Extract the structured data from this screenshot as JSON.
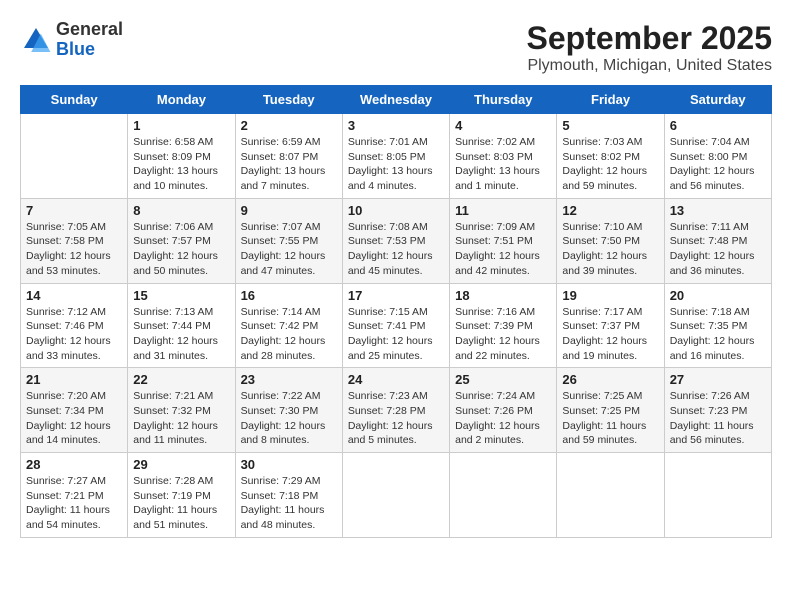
{
  "logo": {
    "general": "General",
    "blue": "Blue"
  },
  "title": "September 2025",
  "subtitle": "Plymouth, Michigan, United States",
  "days_of_week": [
    "Sunday",
    "Monday",
    "Tuesday",
    "Wednesday",
    "Thursday",
    "Friday",
    "Saturday"
  ],
  "weeks": [
    [
      {
        "day": "",
        "info": ""
      },
      {
        "day": "1",
        "info": "Sunrise: 6:58 AM\nSunset: 8:09 PM\nDaylight: 13 hours\nand 10 minutes."
      },
      {
        "day": "2",
        "info": "Sunrise: 6:59 AM\nSunset: 8:07 PM\nDaylight: 13 hours\nand 7 minutes."
      },
      {
        "day": "3",
        "info": "Sunrise: 7:01 AM\nSunset: 8:05 PM\nDaylight: 13 hours\nand 4 minutes."
      },
      {
        "day": "4",
        "info": "Sunrise: 7:02 AM\nSunset: 8:03 PM\nDaylight: 13 hours\nand 1 minute."
      },
      {
        "day": "5",
        "info": "Sunrise: 7:03 AM\nSunset: 8:02 PM\nDaylight: 12 hours\nand 59 minutes."
      },
      {
        "day": "6",
        "info": "Sunrise: 7:04 AM\nSunset: 8:00 PM\nDaylight: 12 hours\nand 56 minutes."
      }
    ],
    [
      {
        "day": "7",
        "info": "Sunrise: 7:05 AM\nSunset: 7:58 PM\nDaylight: 12 hours\nand 53 minutes."
      },
      {
        "day": "8",
        "info": "Sunrise: 7:06 AM\nSunset: 7:57 PM\nDaylight: 12 hours\nand 50 minutes."
      },
      {
        "day": "9",
        "info": "Sunrise: 7:07 AM\nSunset: 7:55 PM\nDaylight: 12 hours\nand 47 minutes."
      },
      {
        "day": "10",
        "info": "Sunrise: 7:08 AM\nSunset: 7:53 PM\nDaylight: 12 hours\nand 45 minutes."
      },
      {
        "day": "11",
        "info": "Sunrise: 7:09 AM\nSunset: 7:51 PM\nDaylight: 12 hours\nand 42 minutes."
      },
      {
        "day": "12",
        "info": "Sunrise: 7:10 AM\nSunset: 7:50 PM\nDaylight: 12 hours\nand 39 minutes."
      },
      {
        "day": "13",
        "info": "Sunrise: 7:11 AM\nSunset: 7:48 PM\nDaylight: 12 hours\nand 36 minutes."
      }
    ],
    [
      {
        "day": "14",
        "info": "Sunrise: 7:12 AM\nSunset: 7:46 PM\nDaylight: 12 hours\nand 33 minutes."
      },
      {
        "day": "15",
        "info": "Sunrise: 7:13 AM\nSunset: 7:44 PM\nDaylight: 12 hours\nand 31 minutes."
      },
      {
        "day": "16",
        "info": "Sunrise: 7:14 AM\nSunset: 7:42 PM\nDaylight: 12 hours\nand 28 minutes."
      },
      {
        "day": "17",
        "info": "Sunrise: 7:15 AM\nSunset: 7:41 PM\nDaylight: 12 hours\nand 25 minutes."
      },
      {
        "day": "18",
        "info": "Sunrise: 7:16 AM\nSunset: 7:39 PM\nDaylight: 12 hours\nand 22 minutes."
      },
      {
        "day": "19",
        "info": "Sunrise: 7:17 AM\nSunset: 7:37 PM\nDaylight: 12 hours\nand 19 minutes."
      },
      {
        "day": "20",
        "info": "Sunrise: 7:18 AM\nSunset: 7:35 PM\nDaylight: 12 hours\nand 16 minutes."
      }
    ],
    [
      {
        "day": "21",
        "info": "Sunrise: 7:20 AM\nSunset: 7:34 PM\nDaylight: 12 hours\nand 14 minutes."
      },
      {
        "day": "22",
        "info": "Sunrise: 7:21 AM\nSunset: 7:32 PM\nDaylight: 12 hours\nand 11 minutes."
      },
      {
        "day": "23",
        "info": "Sunrise: 7:22 AM\nSunset: 7:30 PM\nDaylight: 12 hours\nand 8 minutes."
      },
      {
        "day": "24",
        "info": "Sunrise: 7:23 AM\nSunset: 7:28 PM\nDaylight: 12 hours\nand 5 minutes."
      },
      {
        "day": "25",
        "info": "Sunrise: 7:24 AM\nSunset: 7:26 PM\nDaylight: 12 hours\nand 2 minutes."
      },
      {
        "day": "26",
        "info": "Sunrise: 7:25 AM\nSunset: 7:25 PM\nDaylight: 11 hours\nand 59 minutes."
      },
      {
        "day": "27",
        "info": "Sunrise: 7:26 AM\nSunset: 7:23 PM\nDaylight: 11 hours\nand 56 minutes."
      }
    ],
    [
      {
        "day": "28",
        "info": "Sunrise: 7:27 AM\nSunset: 7:21 PM\nDaylight: 11 hours\nand 54 minutes."
      },
      {
        "day": "29",
        "info": "Sunrise: 7:28 AM\nSunset: 7:19 PM\nDaylight: 11 hours\nand 51 minutes."
      },
      {
        "day": "30",
        "info": "Sunrise: 7:29 AM\nSunset: 7:18 PM\nDaylight: 11 hours\nand 48 minutes."
      },
      {
        "day": "",
        "info": ""
      },
      {
        "day": "",
        "info": ""
      },
      {
        "day": "",
        "info": ""
      },
      {
        "day": "",
        "info": ""
      }
    ]
  ]
}
